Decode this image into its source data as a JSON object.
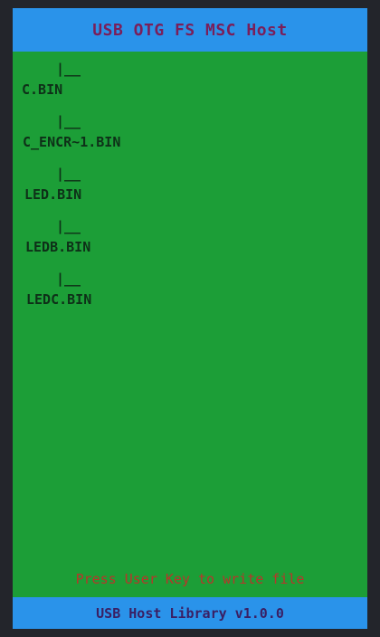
{
  "header": {
    "title": "USB OTG FS MSC Host"
  },
  "files": [
    {
      "branch": "|__",
      "name": "C.BIN"
    },
    {
      "branch": "|__",
      "name": "C_ENCR~1.BIN"
    },
    {
      "branch": "|__",
      "name": "LED.BIN"
    },
    {
      "branch": "|__",
      "name": "LEDB.BIN"
    },
    {
      "branch": "|__",
      "name": "LEDC.BIN"
    }
  ],
  "status": {
    "message": "Press User Key to write file"
  },
  "footer": {
    "library": "USB Host Library v1.0.0"
  },
  "colors": {
    "screen_background": "#1c9e37",
    "bar_background": "#2a93ea",
    "status_text": "#b8352a"
  }
}
